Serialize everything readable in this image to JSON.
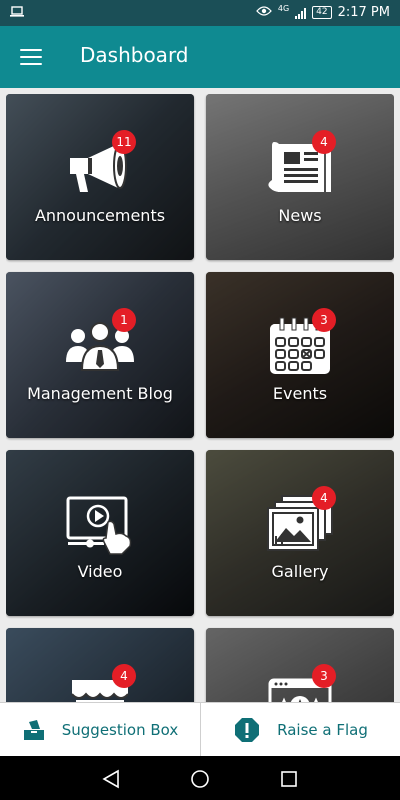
{
  "status_bar": {
    "time": "2:17 PM",
    "network": "4G",
    "battery": "42",
    "icons": [
      "laptop-icon",
      "eye-icon",
      "signal-icon",
      "battery-icon"
    ]
  },
  "app_bar": {
    "title": "Dashboard",
    "menu_icon": "hamburger-menu-icon"
  },
  "colors": {
    "primary": "#0f8a91",
    "status_bar": "#1b4f57",
    "badge": "#e41e26",
    "action_text": "#0f6f76"
  },
  "tiles": [
    {
      "label": "Announcements",
      "badge": "11",
      "icon": "megaphone-icon"
    },
    {
      "label": "News",
      "badge": "4",
      "icon": "newspaper-icon"
    },
    {
      "label": "Management Blog",
      "badge": "1",
      "icon": "people-group-icon"
    },
    {
      "label": "Events",
      "badge": "3",
      "icon": "calendar-icon"
    },
    {
      "label": "Video",
      "badge": "",
      "icon": "video-touch-icon"
    },
    {
      "label": "Gallery",
      "badge": "4",
      "icon": "gallery-icon"
    },
    {
      "label": "",
      "badge": "4",
      "icon": "store-icon"
    },
    {
      "label": "",
      "badge": "3",
      "icon": "rating-stars-icon"
    }
  ],
  "bottom_actions": [
    {
      "label": "Suggestion Box",
      "icon": "ballot-box-icon"
    },
    {
      "label": "Raise a Flag",
      "icon": "alert-icon"
    }
  ],
  "nav_bar": {
    "buttons": [
      "back-icon",
      "home-icon",
      "recents-icon"
    ]
  }
}
